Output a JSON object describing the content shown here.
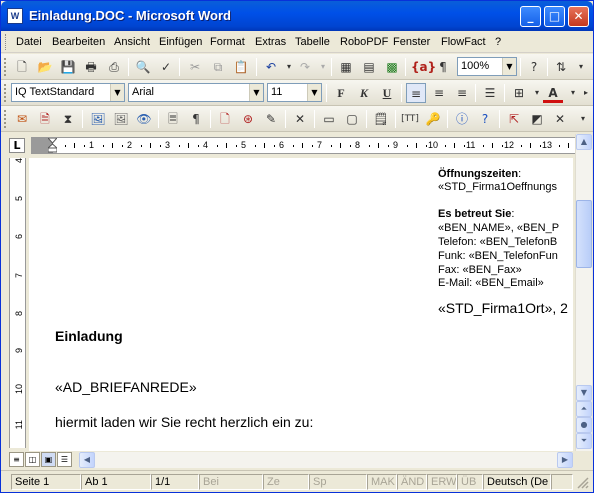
{
  "window": {
    "title": "Einladung.DOC - Microsoft Word",
    "app_icon": "W"
  },
  "menu": [
    "Datei",
    "Bearbeiten",
    "Ansicht",
    "Einfügen",
    "Format",
    "Extras",
    "Tabelle",
    "RoboPDF",
    "Fenster",
    "FlowFact",
    "?"
  ],
  "formatting": {
    "style": "IQ TextStandard",
    "font": "Arial",
    "size": "11",
    "zoom": "100%",
    "bold": "F",
    "italic": "K",
    "underline": "U"
  },
  "ruler": {
    "corner": "L",
    "ticks": [
      "1",
      "2",
      "3",
      "4",
      "5",
      "6",
      "7",
      "8",
      "9",
      "10",
      "11",
      "12",
      "13"
    ],
    "vticks": [
      "4",
      "5",
      "6",
      "7",
      "8",
      "9",
      "10",
      "11"
    ]
  },
  "document": {
    "hours_label": "Öffnungszeiten",
    "hours_value": "«STD_Firma1Oeffnungs",
    "served_label": "Es betreut Sie",
    "contact_name": "«BEN_NAME», «BEN_P",
    "phone": "Telefon: «BEN_TelefonB",
    "mobile": "Funk: «BEN_TelefonFun",
    "fax": "Fax: «BEN_Fax»",
    "email": "E-Mail: «BEN_Email»",
    "place_date": "«STD_Firma1Ort», 2",
    "heading": "Einladung",
    "salutation": "«AD_BRIEFANREDE»",
    "body_line": "hiermit laden wir Sie recht herzlich ein zu:"
  },
  "status": {
    "page": "Seite  1",
    "section": "Ab  1",
    "pages": "1/1",
    "at": "Bei",
    "line": "Ze",
    "column": "Sp",
    "mak": "MAK",
    "aend": "ÄND",
    "erw": "ERW",
    "ueb": "ÜB",
    "language": "Deutsch (De"
  }
}
